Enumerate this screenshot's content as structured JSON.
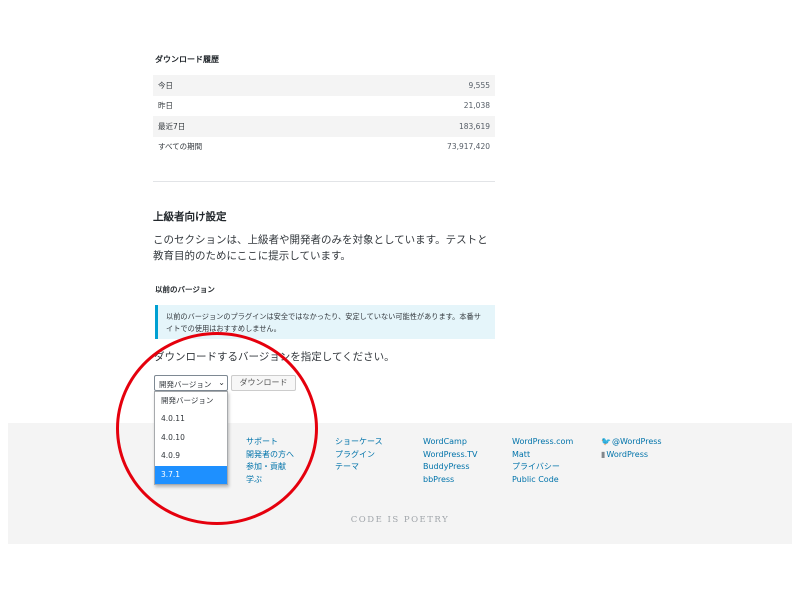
{
  "stats": {
    "heading": "ダウンロード履歴",
    "rows": [
      {
        "label": "今日",
        "value": "9,555"
      },
      {
        "label": "昨日",
        "value": "21,038"
      },
      {
        "label": "最近7日",
        "value": "183,619"
      },
      {
        "label": "すべての期間",
        "value": "73,917,420"
      }
    ]
  },
  "advanced": {
    "title": "上級者向け設定",
    "description": "このセクションは、上級者や開発者のみを対象としています。テストと教育目的のためにここに提示しています。"
  },
  "previous": {
    "heading": "以前のバージョン",
    "notice": "以前のバージョンのプラグインは安全ではなかったり、安定していない可能性があります。本番サイトでの使用はおすすめしません。",
    "choose_label": "ダウンロードするバージョンを指定してください。",
    "select_value": "開発バージョン",
    "download_button": "ダウンロード",
    "options": [
      "開発バージョン",
      "4.0.11",
      "4.0.10",
      "4.0.9",
      "3.7.1"
    ],
    "highlighted_option": "3.7.1"
  },
  "footer": {
    "col1": [
      "サポート",
      "開発者の方へ",
      "参加・貢献",
      "学ぶ"
    ],
    "col2": [
      "ショーケース",
      "プラグイン",
      "テーマ"
    ],
    "col3": [
      "WordCamp",
      "WordPress.TV",
      "BuddyPress",
      "bbPress"
    ],
    "col4": [
      "WordPress.com",
      "Matt",
      "プライバシー",
      "Public Code"
    ],
    "social": {
      "twitter": "@WordPress",
      "facebook": "WordPress"
    },
    "tagline": "CODE IS POETRY"
  },
  "colors": {
    "link": "#0073aa",
    "highlight": "#1e90ff",
    "annotation": "#e5000d",
    "notice_border": "#00a0d2"
  }
}
